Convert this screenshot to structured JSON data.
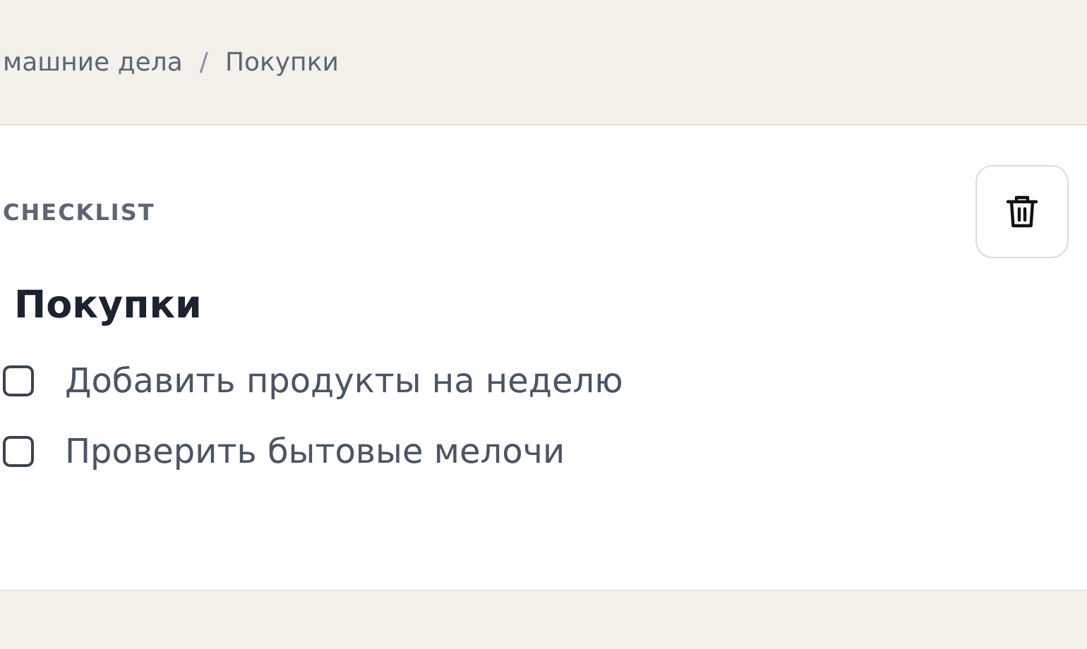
{
  "breadcrumb": {
    "items": [
      "машние дела",
      "Покупки"
    ],
    "separator": "/"
  },
  "checklist": {
    "label": "CHECKLIST",
    "title": "Покупки",
    "items": [
      {
        "text": "Добавить продукты на неделю",
        "checked": false
      },
      {
        "text": "Проверить бытовые мелочи",
        "checked": false
      }
    ]
  }
}
